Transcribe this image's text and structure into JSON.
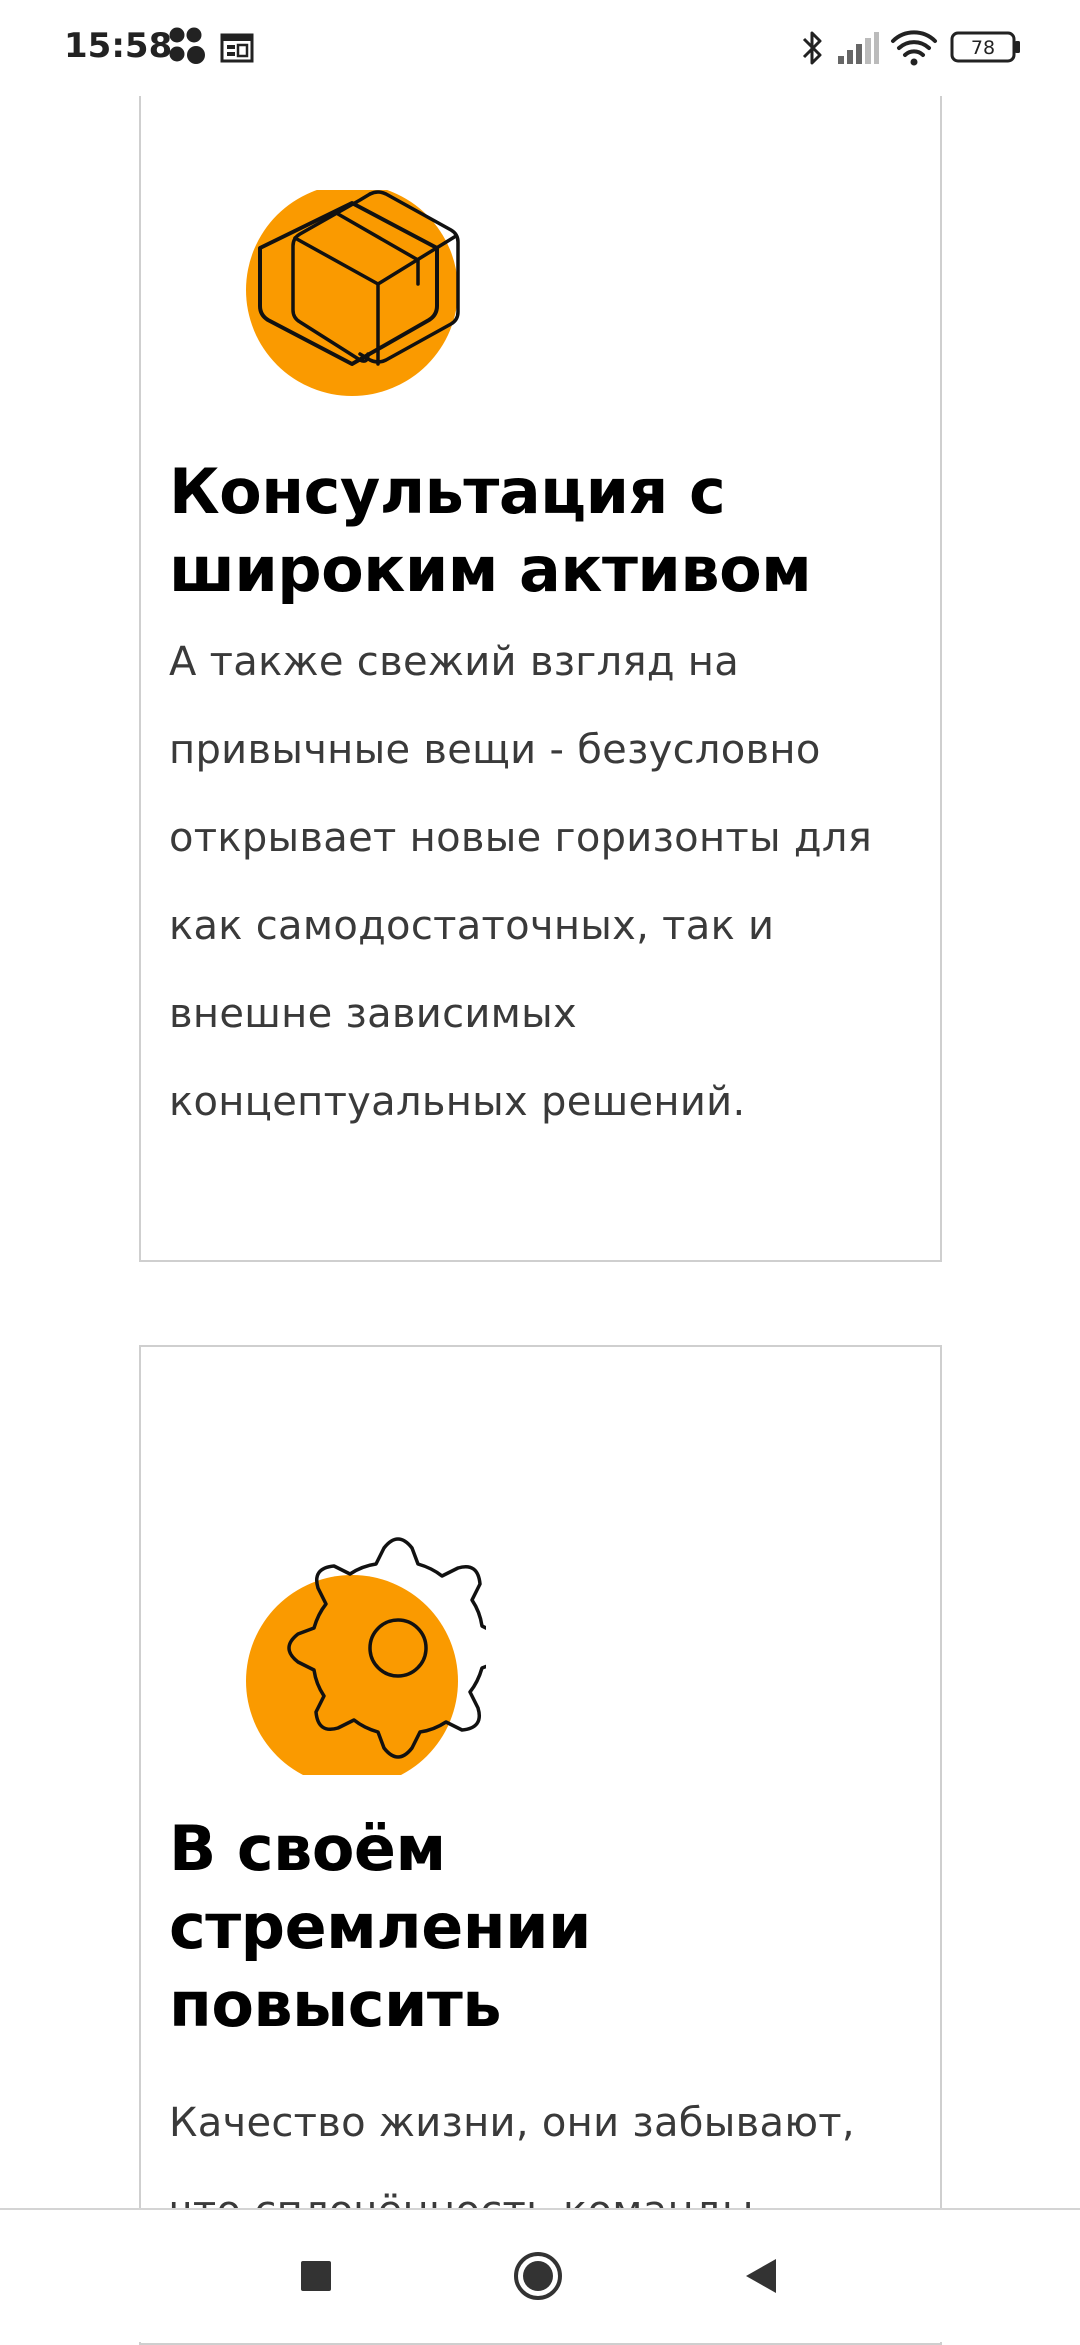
{
  "status_bar": {
    "time": "15:58",
    "battery": "78",
    "icons": [
      "assistant-dots-icon",
      "calendar-notification-icon",
      "bluetooth-icon",
      "cellular-signal-icon",
      "wifi-icon",
      "battery-icon"
    ]
  },
  "cards": [
    {
      "icon": "box-icon",
      "title": "Консультация с широким активом",
      "text": "А также свежий взгляд на привычные вещи - безусловно открывает новые горизонты для как самодостаточных, так и внешне зависимых концептуальных решений."
    },
    {
      "icon": "gear-icon",
      "title": "В своём стремлении повысить",
      "text": "Качество жизни, они забывают, что сплочённость команды"
    }
  ],
  "colors": {
    "accent": "#FA9A00",
    "border": "#CFCFCF",
    "text": "#3A3A3A"
  },
  "nav_bar": {
    "buttons": [
      "recents-square-icon",
      "home-circle-icon",
      "back-triangle-icon"
    ]
  }
}
